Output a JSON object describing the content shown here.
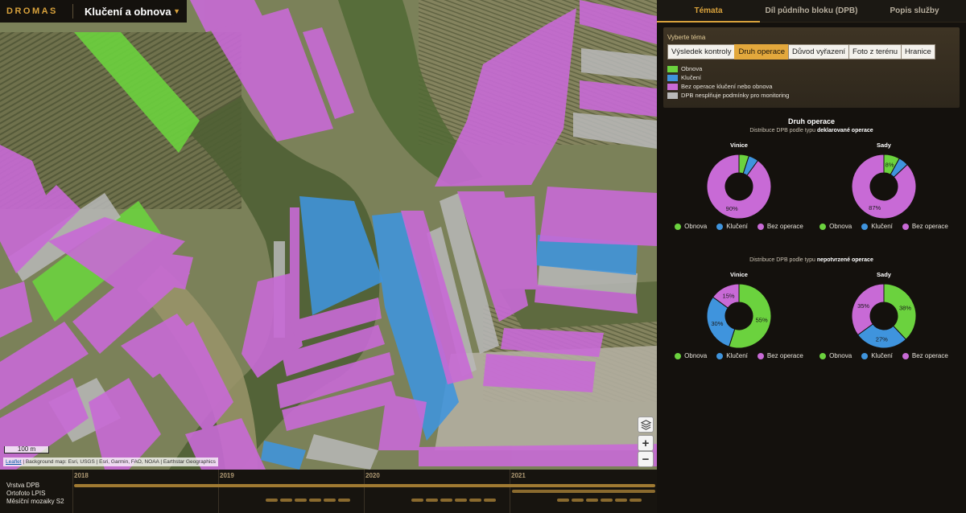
{
  "brand": {
    "logo": "DROMAS",
    "title": "Klučení a obnova"
  },
  "map": {
    "scale_label": "100 m",
    "attribution_link": "Leaflet",
    "attribution_text": "| Background map: Esri, USGS | Esri, Garmin, FAO, NOAA | Earthstar Geographics",
    "zoom_in": "+",
    "zoom_out": "−"
  },
  "timeline": {
    "rows": [
      "Vrstva DPB",
      "Ortofoto LPIS",
      "Měsíční mozaiky S2"
    ],
    "years": [
      "2018",
      "2019",
      "2020",
      "2021"
    ]
  },
  "tabs": [
    "Témata",
    "Díl půdního bloku (DPB)",
    "Popis služby"
  ],
  "theme": {
    "label": "Vyberte téma",
    "buttons": [
      "Výsledek kontroly",
      "Druh operace",
      "Důvod vyřazení",
      "Foto z terénu",
      "Hranice"
    ],
    "active_index": 1
  },
  "legend": [
    {
      "label": "Obnova",
      "color": "#6bd23e"
    },
    {
      "label": "Klučení",
      "color": "#3f94dd"
    },
    {
      "label": "Bez operace klučení nebo obnova",
      "color": "#c86ad6"
    },
    {
      "label": "DPB nesplňuje podmínky pro monitoring",
      "color": "#b8b8b8"
    }
  ],
  "stats": {
    "title": "Druh operace",
    "sub1_prefix": "Distribuce DPB podle typu ",
    "sub1_bold": "deklarované operace",
    "sub2_prefix": "Distribuce DPB podle typu ",
    "sub2_bold": "nepotvrzené operace",
    "legend_labels": [
      "Obnova",
      "Klučení",
      "Bez operace"
    ]
  },
  "colors": {
    "obnova": "#6bd23e",
    "kluceni": "#3f94dd",
    "bez": "#c86ad6",
    "accent": "#d9a23c"
  },
  "chart_data": [
    {
      "type": "pie",
      "title": "Vinice",
      "categories": [
        "Obnova",
        "Klučení",
        "Bez operace"
      ],
      "values": [
        5,
        5,
        90
      ],
      "labels": [
        "",
        "",
        "90%"
      ]
    },
    {
      "type": "pie",
      "title": "Sady",
      "categories": [
        "Obnova",
        "Klučení",
        "Bez operace"
      ],
      "values": [
        8,
        5,
        87
      ],
      "labels": [
        "8%",
        "",
        "87%"
      ]
    },
    {
      "type": "pie",
      "title": "Vinice",
      "categories": [
        "Obnova",
        "Klučení",
        "Bez operace"
      ],
      "values": [
        55,
        30,
        15
      ],
      "labels": [
        "55%",
        "30%",
        "15%"
      ]
    },
    {
      "type": "pie",
      "title": "Sady",
      "categories": [
        "Obnova",
        "Klučení",
        "Bez operace"
      ],
      "values": [
        38,
        27,
        35
      ],
      "labels": [
        "38%",
        "27%",
        "35%"
      ]
    }
  ]
}
